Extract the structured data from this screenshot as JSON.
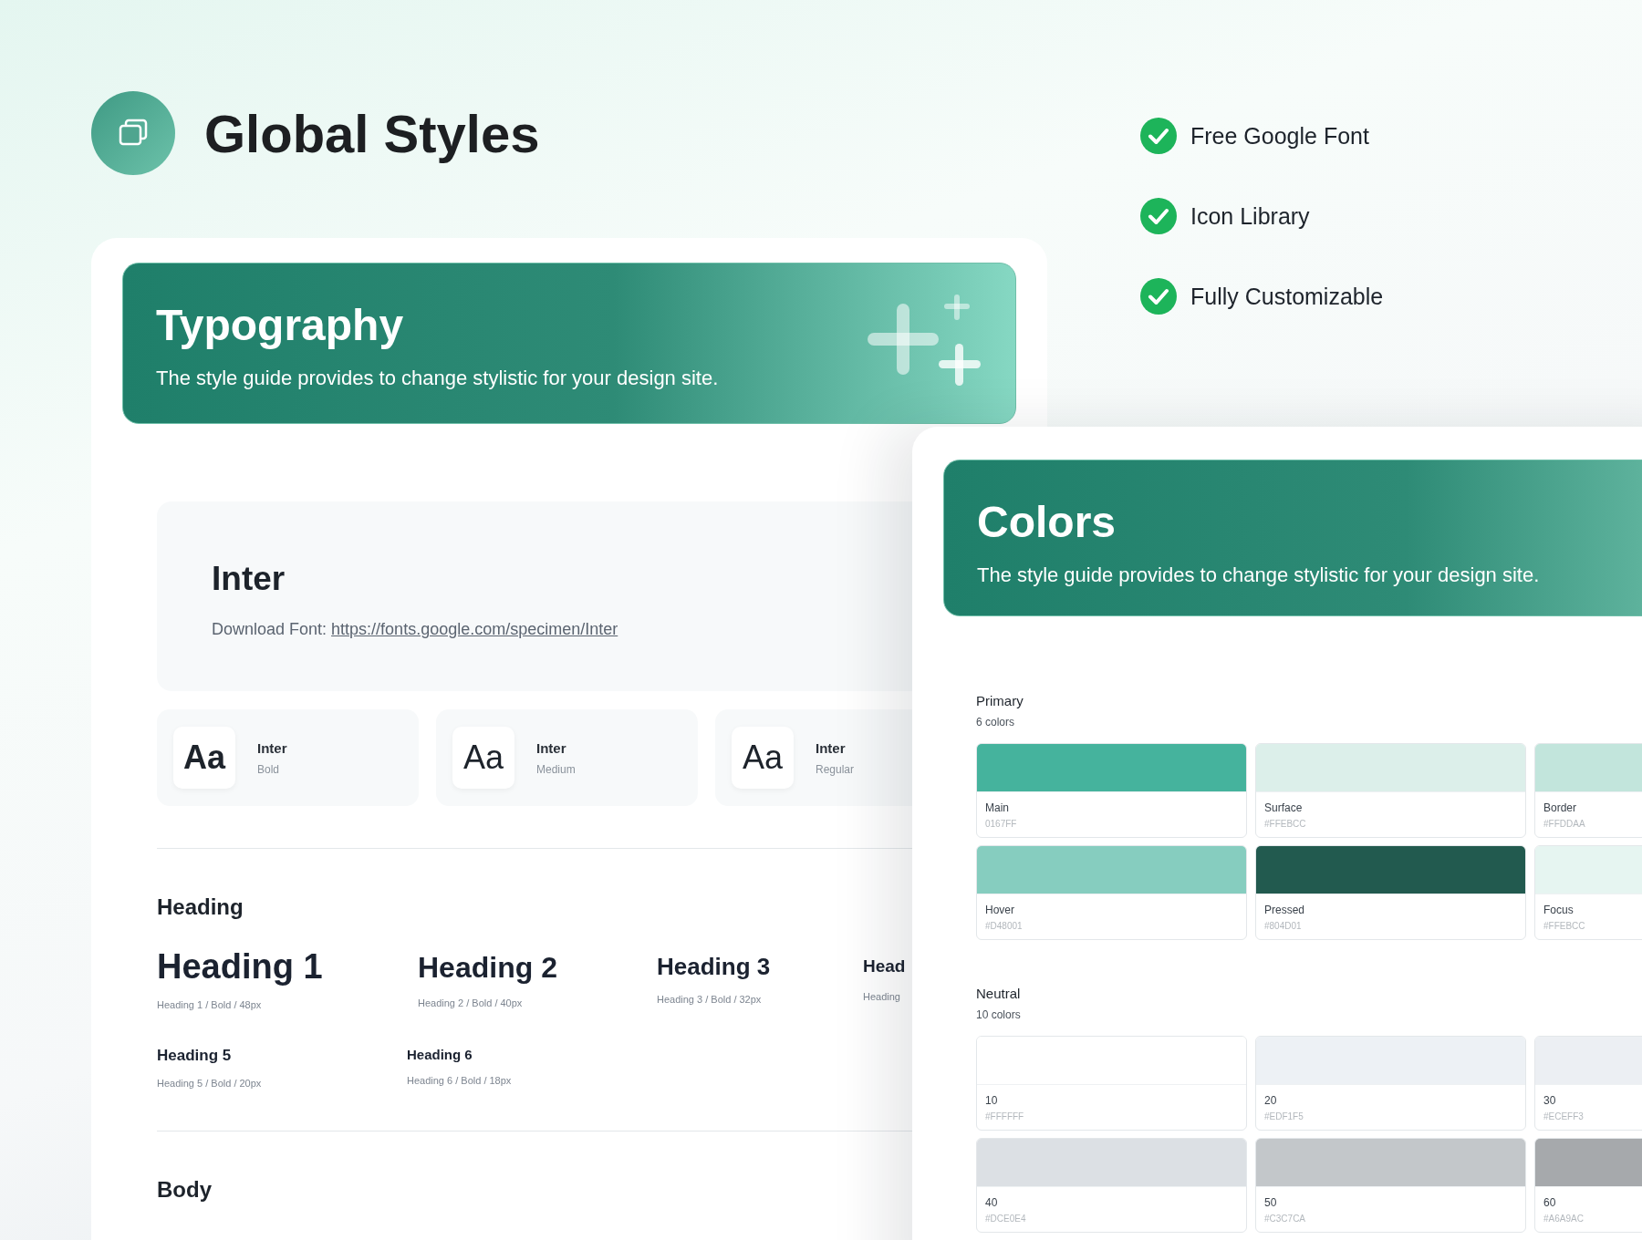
{
  "header": {
    "title": "Global Styles"
  },
  "features": [
    {
      "label": "Free Google Font",
      "checked": true
    },
    {
      "label": "Icon Library",
      "checked": true
    },
    {
      "label": "Fully Customizable",
      "checked": true
    }
  ],
  "typography": {
    "banner": {
      "title": "Typography",
      "subtitle": "The style guide provides to change stylistic for your design site."
    },
    "font": {
      "name": "Inter",
      "download_label": "Download Font:",
      "link": "https://fonts.google.com/specimen/Inter"
    },
    "weights": [
      {
        "sample": "Aa",
        "family": "Inter",
        "weight": "Bold",
        "kind": "bold"
      },
      {
        "sample": "Aa",
        "family": "Inter",
        "weight": "Medium",
        "kind": "medium"
      },
      {
        "sample": "Aa",
        "family": "Inter",
        "weight": "Regular",
        "kind": "regular"
      }
    ],
    "heading_section": "Heading",
    "headings": [
      {
        "title": "Heading 1",
        "spec": "Heading 1 / Bold / 48px",
        "kind": "h1"
      },
      {
        "title": "Heading 2",
        "spec": "Heading 2 / Bold / 40px",
        "kind": "h2"
      },
      {
        "title": "Heading 3",
        "spec": "Heading 3 / Bold / 32px",
        "kind": "h3"
      },
      {
        "title": "Head",
        "spec": "Heading",
        "kind": "h4"
      },
      {
        "title": "Heading 5",
        "spec": "Heading 5 / Bold / 20px",
        "kind": "h5"
      },
      {
        "title": "Heading 6",
        "spec": "Heading 6 / Bold / 18px",
        "kind": "h6"
      }
    ],
    "body_section": "Body"
  },
  "colors": {
    "banner": {
      "title": "Colors",
      "subtitle": "The style guide provides to change stylistic for your design site."
    },
    "groups": [
      {
        "name": "Primary",
        "count": "6 colors",
        "swatches": [
          {
            "name": "Main",
            "hex": "0167FF",
            "color": "#45b39d"
          },
          {
            "name": "Surface",
            "hex": "#FFEBCC",
            "color": "#dcefea"
          },
          {
            "name": "Border",
            "hex": "#FFDDAA",
            "color": "#c2e5dc"
          },
          {
            "name": "Hover",
            "hex": "#D48001",
            "color": "#86cdbf"
          },
          {
            "name": "Pressed",
            "hex": "#804D01",
            "color": "#225a4f"
          },
          {
            "name": "Focus",
            "hex": "#FFEBCC",
            "color": "#e6f5f1"
          }
        ]
      },
      {
        "name": "Neutral",
        "count": "10 colors",
        "swatches": [
          {
            "name": "10",
            "hex": "#FFFFFF",
            "color": "#ffffff"
          },
          {
            "name": "20",
            "hex": "#EDF1F5",
            "color": "#edf1f5"
          },
          {
            "name": "30",
            "hex": "#ECEFF3",
            "color": "#eceff3"
          },
          {
            "name": "40",
            "hex": "#DCE0E4",
            "color": "#dce0e4"
          },
          {
            "name": "50",
            "hex": "#C3C7CA",
            "color": "#c3c7ca"
          },
          {
            "name": "60",
            "hex": "#A6A9AC",
            "color": "#a6a9ac"
          }
        ]
      }
    ]
  }
}
